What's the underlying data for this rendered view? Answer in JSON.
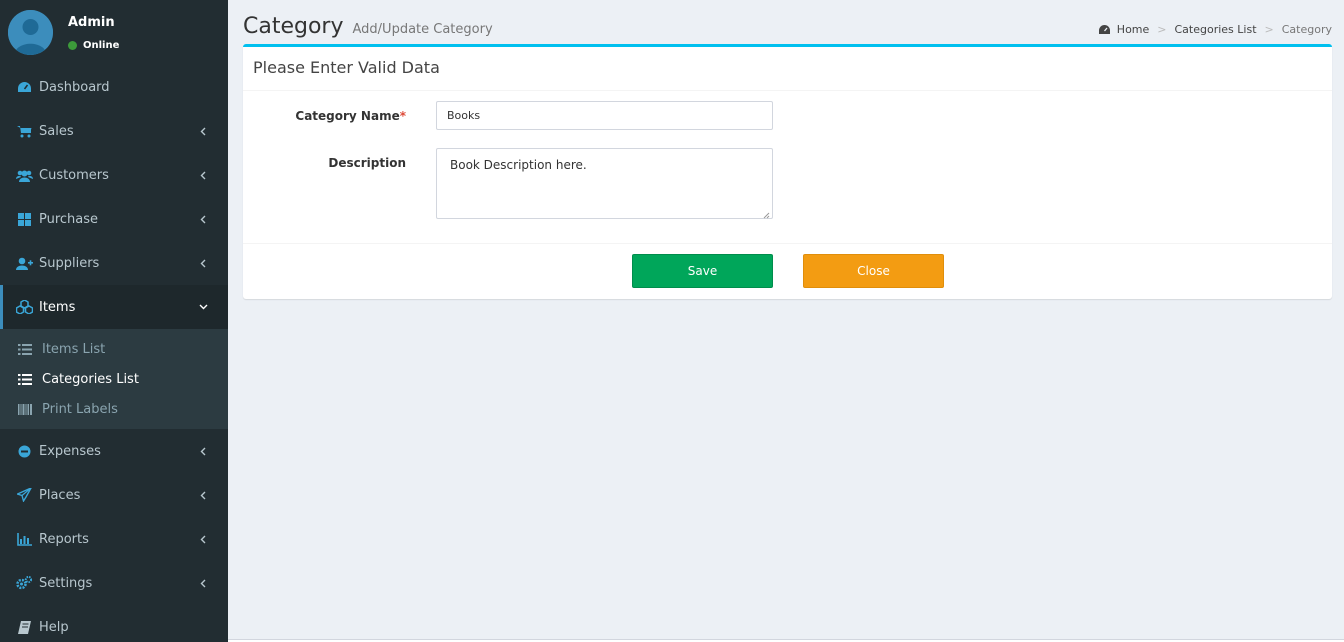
{
  "user": {
    "name": "Admin",
    "status": "Online"
  },
  "sidebar": {
    "items": [
      {
        "label": "Dashboard",
        "icon": "dashboard-icon"
      },
      {
        "label": "Sales",
        "icon": "cart-icon"
      },
      {
        "label": "Customers",
        "icon": "users-icon"
      },
      {
        "label": "Purchase",
        "icon": "grid-icon"
      },
      {
        "label": "Suppliers",
        "icon": "user-plus-icon"
      },
      {
        "label": "Items",
        "icon": "cubes-icon"
      },
      {
        "label": "Expenses",
        "icon": "minus-circle-icon"
      },
      {
        "label": "Places",
        "icon": "paper-plane-icon"
      },
      {
        "label": "Reports",
        "icon": "bar-chart-icon"
      },
      {
        "label": "Settings",
        "icon": "cogs-icon"
      },
      {
        "label": "Help",
        "icon": "book-icon"
      }
    ],
    "submenu": [
      {
        "label": "Items List",
        "icon": "list-icon"
      },
      {
        "label": "Categories List",
        "icon": "list-icon"
      },
      {
        "label": "Print Labels",
        "icon": "barcode-icon"
      }
    ]
  },
  "header": {
    "title": "Category",
    "subtitle": "Add/Update Category"
  },
  "breadcrumb": {
    "home": "Home",
    "list": "Categories List",
    "current": "Category"
  },
  "form": {
    "box_title": "Please Enter Valid Data",
    "category_name_label": "Category Name",
    "required_mark": "*",
    "category_name_value": "Books",
    "description_label": "Description",
    "description_value": "Book Description here.",
    "save_label": "Save",
    "close_label": "Close"
  },
  "colors": {
    "sidebar_bg": "#222d32",
    "accent": "#00c0ef",
    "save": "#00a65a",
    "close": "#f39c12",
    "online": "#3c9a3a"
  }
}
